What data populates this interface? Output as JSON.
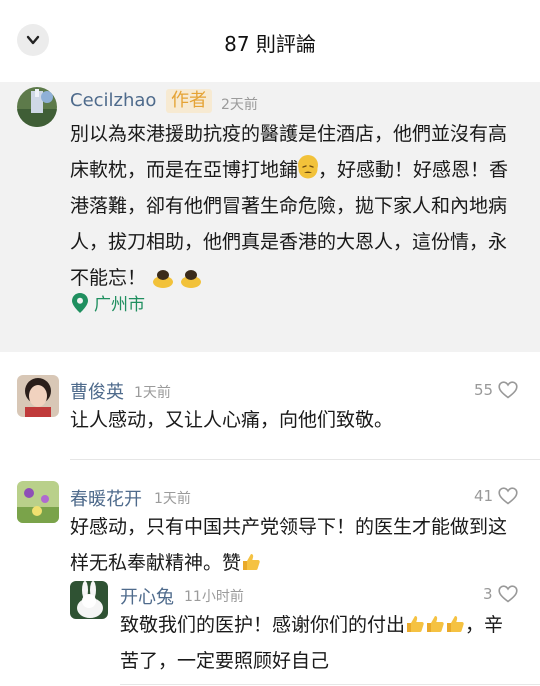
{
  "header": {
    "title": "87 則評論"
  },
  "author_comment": {
    "name": "Cecilzhao",
    "tag": "作者",
    "time": "2天前",
    "lines": [
      "別以為來港援助抗疫的醫護是住酒店，他們並沒有高",
      "床軟枕，而是在亞博打地鋪",
      "，好感動！好感恩！香",
      "港落難，卻有他們冒著生命危險，拋下家人和內地病",
      "人，拔刀相助，他們真是香港的大恩人，這份情，永",
      "不能忘！"
    ],
    "location": "广州市"
  },
  "comments": [
    {
      "name": "曹俊英",
      "time": "1天前",
      "likes": "55",
      "text": "让人感动，又让人心痛，向他们致敬。"
    },
    {
      "name": "春暖花开",
      "time": "1天前",
      "likes": "41",
      "line1": "好感动，只有中国共产党领导下！的医生才能做到这",
      "line2": "样无私奉献精神。赞"
    },
    {
      "name": "开心兔",
      "time": "11小时前",
      "likes": "3",
      "line1a": "致敬我们的医护！感谢你们的付出",
      "line1b": "，辛",
      "line2": "苦了，一定要照顾好自己"
    }
  ],
  "icons": {
    "back": "chevron-down-icon",
    "location": "location-pin-icon",
    "like": "heart-icon"
  },
  "colors": {
    "name": "#4f6b8c",
    "tag": "#e5a335",
    "location": "#1f8f5f"
  }
}
